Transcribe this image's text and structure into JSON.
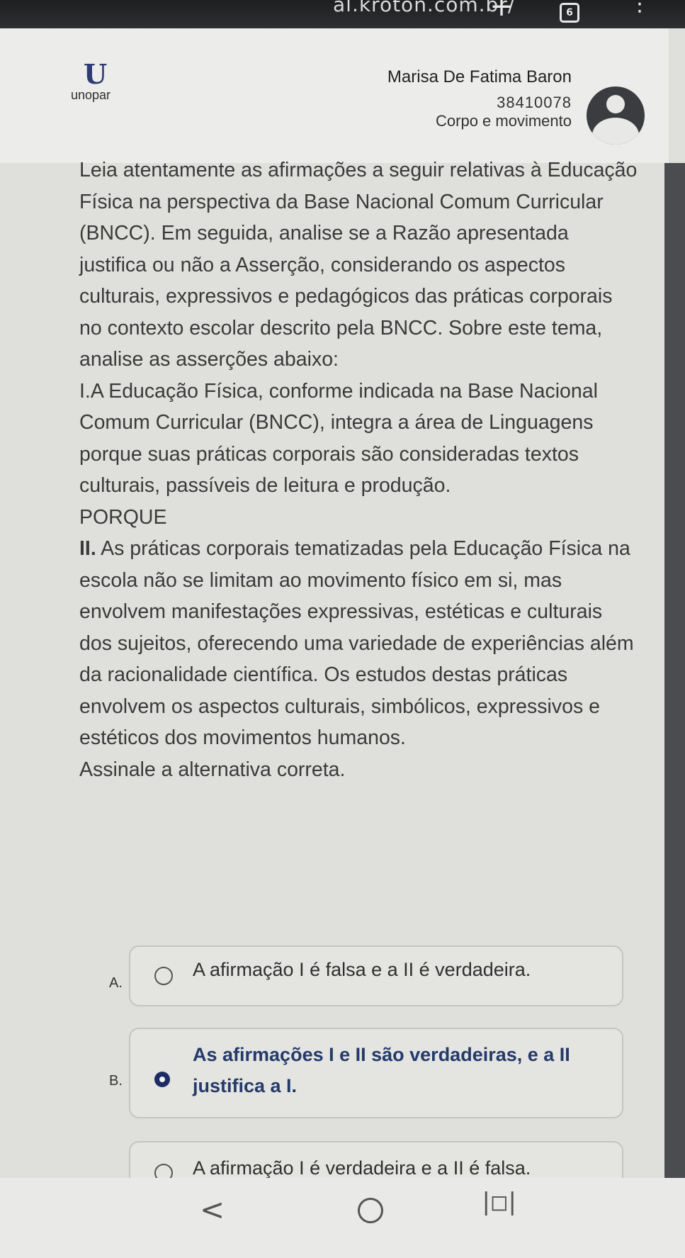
{
  "browser": {
    "url": "ál.kroton.com.br/",
    "tab_count": "6"
  },
  "header": {
    "logo_text": "unopar",
    "user_name": "Marisa De Fatima Baron",
    "user_id": "38410078",
    "course": "Corpo e movimento"
  },
  "question": {
    "intro": "Leia atentamente as afirmações a seguir relativas à Educação Física na perspectiva da Base Nacional Comum Curricular (BNCC). Em seguida, analise se a Razão apresentada justifica ou não a Asserção, considerando os aspectos culturais, expressivos e pedagógicos das práticas corporais no contexto escolar descrito pela BNCC. Sobre este tema, analise as asserções abaixo:",
    "assertion_1": "I.A Educação Física, conforme indicada na Base Nacional Comum Curricular (BNCC), integra a área de Linguagens porque suas práticas corporais são consideradas textos culturais, passíveis de leitura e produção.",
    "connector": "PORQUE",
    "assertion_2_label": "II.",
    "assertion_2": " As práticas corporais tematizadas pela Educação Física na escola não se limitam ao movimento físico em si, mas envolvem manifestações expressivas, estéticas e culturais dos sujeitos, oferecendo uma variedade de experiências além da racionalidade científica. Os estudos destas práticas envolvem os aspectos culturais, simbólicos, expressivos e estéticos dos movimentos humanos.",
    "instruction": "Assinale a alternativa correta."
  },
  "options": [
    {
      "letter": "A.",
      "text": "A afirmação I é falsa e a II é verdadeira.",
      "selected": false
    },
    {
      "letter": "B.",
      "text": "As afirmações I e II são verdadeiras, e a II justifica a I.",
      "selected": true
    },
    {
      "letter": "C.",
      "text": "A afirmação I é verdadeira e a II é falsa.",
      "selected": false
    }
  ],
  "colors": {
    "accent": "#1c2b66",
    "selected_text": "#243a6b"
  },
  "icons": {
    "plus": "plus-icon",
    "tabs": "tab-count-icon",
    "menu": "kebab-menu-icon",
    "avatar": "user-avatar-icon",
    "back": "back-chevron-icon",
    "home": "home-circle-icon",
    "recent": "recent-apps-icon"
  }
}
